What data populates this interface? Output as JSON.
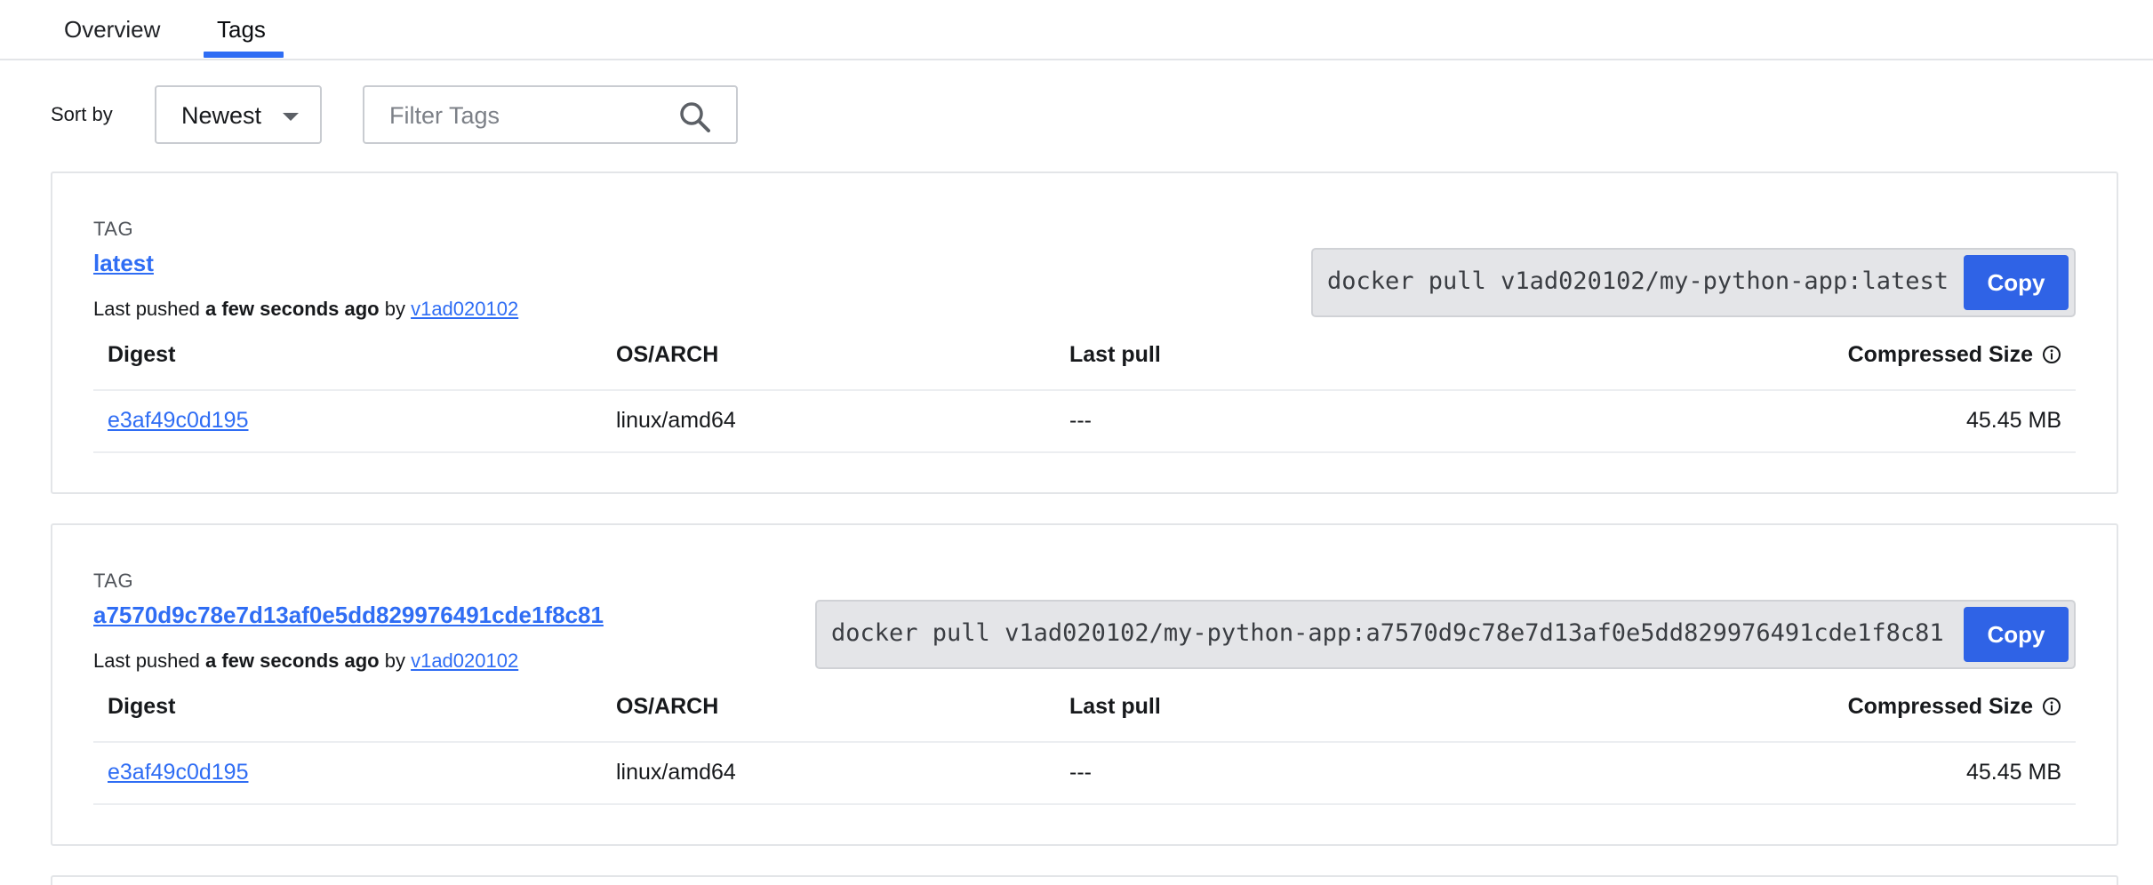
{
  "tabs": [
    {
      "label": "Overview"
    },
    {
      "label": "Tags",
      "active": true
    }
  ],
  "toolbar": {
    "sort_label": "Sort by",
    "sort_value": "Newest",
    "filter_placeholder": "Filter Tags"
  },
  "tags": [
    {
      "caption": "TAG",
      "name": "latest",
      "pushed_prefix": "Last pushed ",
      "pushed_when": "a few seconds ago",
      "pushed_by_word": " by ",
      "pushed_by": "v1ad020102",
      "pull_command": "docker pull v1ad020102/my-python-app:latest",
      "copy_label": "Copy",
      "columns": [
        "Digest",
        "OS/ARCH",
        "Last pull",
        "Compressed Size"
      ],
      "row": {
        "digest": "e3af49c0d195",
        "os_arch": "linux/amd64",
        "last_pull": "---",
        "size": "45.45 MB"
      }
    },
    {
      "caption": "TAG",
      "name": "a7570d9c78e7d13af0e5dd829976491cde1f8c81",
      "pushed_prefix": "Last pushed ",
      "pushed_when": "a few seconds ago",
      "pushed_by_word": " by ",
      "pushed_by": "v1ad020102",
      "pull_command": "docker pull v1ad020102/my-python-app:a7570d9c78e7d13af0e5dd829976491cde1f8c81",
      "copy_label": "Copy",
      "columns": [
        "Digest",
        "OS/ARCH",
        "Last pull",
        "Compressed Size"
      ],
      "row": {
        "digest": "e3af49c0d195",
        "os_arch": "linux/amd64",
        "last_pull": "---",
        "size": "45.45 MB"
      }
    }
  ],
  "colors": {
    "accent": "#2f6df4",
    "button": "#2f63e6",
    "border": "#e3e5e8",
    "command_bg": "#e4e5e8"
  },
  "icons": {
    "sort": "chevron-down-icon",
    "filter": "search-icon",
    "size_info": "info-icon"
  }
}
